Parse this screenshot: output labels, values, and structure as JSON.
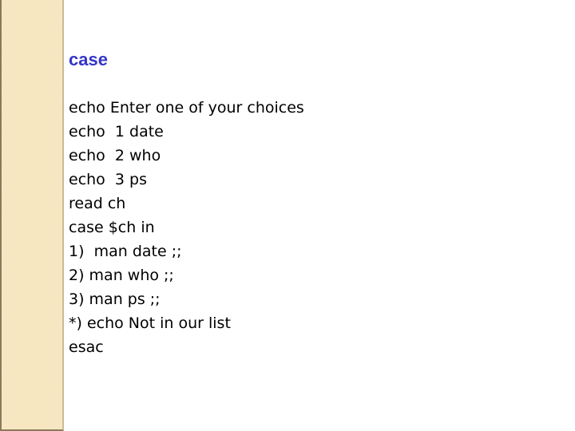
{
  "slide": {
    "title": "case",
    "lines": [
      "echo Enter one of your choices",
      "echo  1 date",
      "echo  2 who",
      "echo  3 ps",
      "read ch",
      "case $ch in",
      "1)  man date ;;",
      "2) man who ;;",
      "3) man ps ;;",
      "*) echo Not in our list",
      "esac"
    ]
  },
  "colors": {
    "title": "#3535c8",
    "sidebar": "#f6e4bb",
    "text": "#000000",
    "background": "#ffffff"
  }
}
